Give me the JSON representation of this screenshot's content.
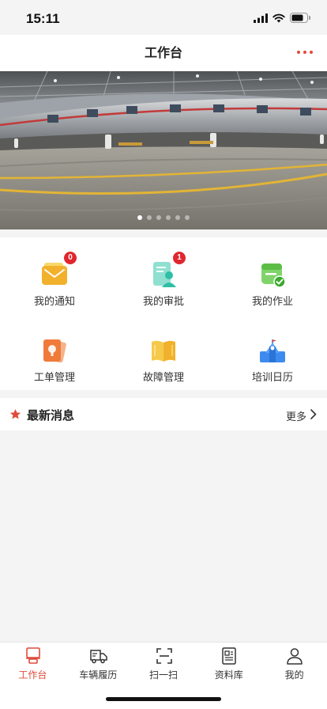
{
  "status_bar": {
    "time": "15:11"
  },
  "nav": {
    "title": "工作台"
  },
  "banner": {
    "page_count": 6,
    "active_page": 1
  },
  "grid": {
    "items": [
      {
        "label": "我的通知",
        "badge": "0",
        "icon": "mail-icon"
      },
      {
        "label": "我的审批",
        "badge": "1",
        "icon": "approval-icon"
      },
      {
        "label": "我的作业",
        "badge": "",
        "icon": "task-icon"
      },
      {
        "label": "工单管理",
        "badge": "",
        "icon": "work-order-icon"
      },
      {
        "label": "故障管理",
        "badge": "",
        "icon": "fault-book-icon"
      },
      {
        "label": "培训日历",
        "badge": "",
        "icon": "training-building-icon"
      }
    ]
  },
  "news": {
    "title": "最新消息",
    "more": "更多"
  },
  "tabbar": {
    "items": [
      {
        "label": "工作台",
        "icon": "workbench-icon",
        "active": true
      },
      {
        "label": "车辆履历",
        "icon": "truck-icon",
        "active": false
      },
      {
        "label": "扫一扫",
        "icon": "scan-icon",
        "active": false
      },
      {
        "label": "资料库",
        "icon": "newspaper-icon",
        "active": false
      },
      {
        "label": "我的",
        "icon": "user-icon",
        "active": false
      }
    ]
  },
  "colors": {
    "accent": "#e04a3a",
    "badge": "#e0262e",
    "background": "#f4f4f4"
  }
}
